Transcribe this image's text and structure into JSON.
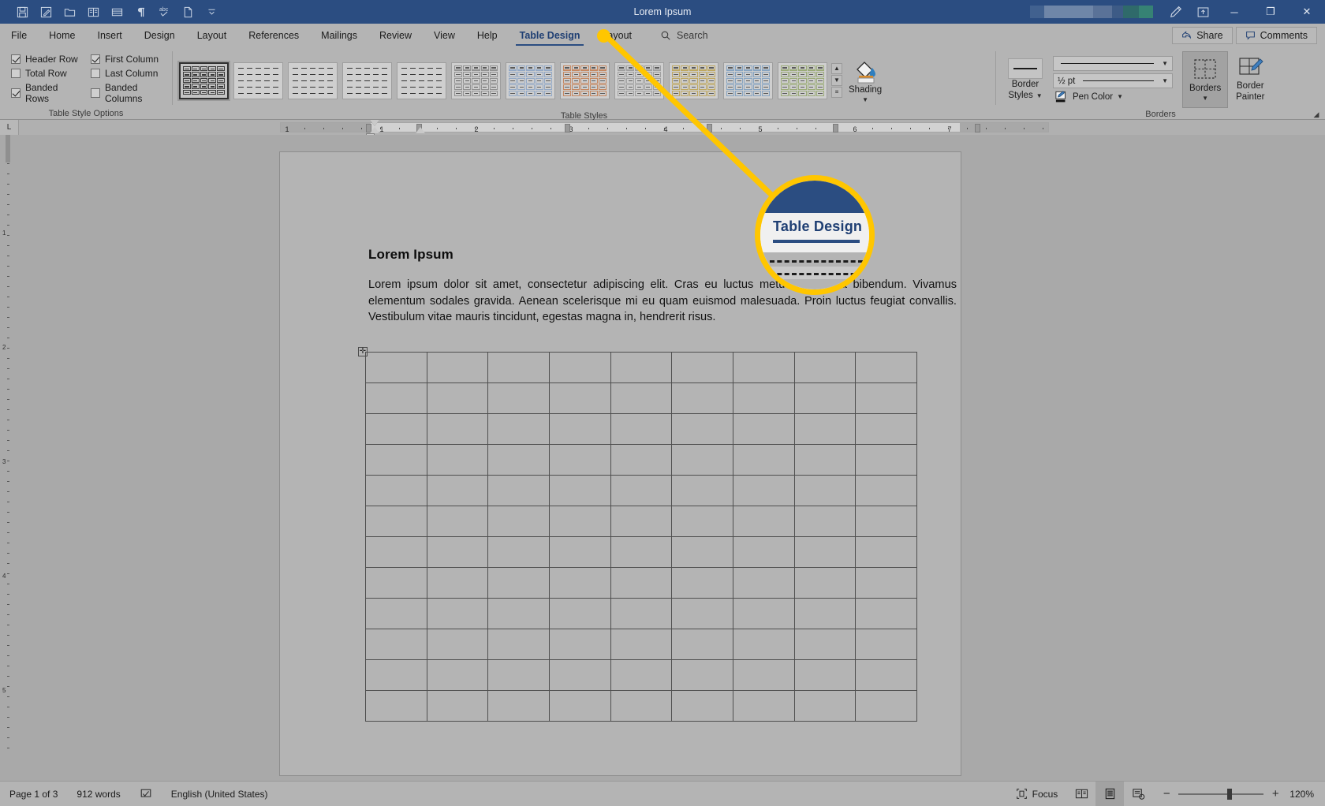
{
  "app": {
    "title": "Lorem Ipsum",
    "accent_blue": "#2b4d81",
    "callout_yellow": "#ffc600"
  },
  "quick_access": [
    {
      "name": "save-icon",
      "tooltip": "Save"
    },
    {
      "name": "autosave-icon",
      "tooltip": "AutoSave"
    },
    {
      "name": "open-folder-icon",
      "tooltip": "Open"
    },
    {
      "name": "read-mode-icon",
      "tooltip": "Read Mode"
    },
    {
      "name": "print-preview-icon",
      "tooltip": "Print Preview"
    },
    {
      "name": "paragraph-marks-icon",
      "tooltip": "Show/Hide Formatting"
    },
    {
      "name": "spelling-icon",
      "tooltip": "Spelling & Grammar"
    },
    {
      "name": "new-document-icon",
      "tooltip": "New"
    },
    {
      "name": "customize-qat-icon",
      "tooltip": "Customize Quick Access Toolbar"
    }
  ],
  "titlebar_right": {
    "pen_icon": "pen-icon",
    "ribbon_display_icon": "ribbon-display-options-icon",
    "minimize": "─",
    "restore": "❐",
    "close": "✕"
  },
  "tabs": [
    {
      "label": "File",
      "active": false
    },
    {
      "label": "Home",
      "active": false
    },
    {
      "label": "Insert",
      "active": false
    },
    {
      "label": "Design",
      "active": false
    },
    {
      "label": "Layout",
      "active": false
    },
    {
      "label": "References",
      "active": false
    },
    {
      "label": "Mailings",
      "active": false
    },
    {
      "label": "Review",
      "active": false
    },
    {
      "label": "View",
      "active": false
    },
    {
      "label": "Help",
      "active": false
    },
    {
      "label": "Table Design",
      "active": true
    },
    {
      "label": "Layout",
      "active": false
    }
  ],
  "search": {
    "placeholder": "Search",
    "value": "Search"
  },
  "tabstrip_right": {
    "share_label": "Share",
    "comments_label": "Comments"
  },
  "ribbon": {
    "groups": [
      {
        "label": "Table Style Options"
      },
      {
        "label": "Table Styles"
      },
      {
        "label": "Borders"
      }
    ],
    "table_style_options": [
      {
        "label": "Header Row",
        "checked": true
      },
      {
        "label": "First Column",
        "checked": true
      },
      {
        "label": "Total Row",
        "checked": false
      },
      {
        "label": "Last Column",
        "checked": false
      },
      {
        "label": "Banded Rows",
        "checked": true
      },
      {
        "label": "Banded Columns",
        "checked": false
      }
    ],
    "table_styles": [
      {
        "name": "Table Grid",
        "color": "#2f2f2f",
        "selected": true,
        "header": false
      },
      {
        "name": "Plain Table 1",
        "color": "#9a9a9a",
        "selected": false,
        "header": false
      },
      {
        "name": "Plain Table 2",
        "color": "#9a9a9a",
        "selected": false,
        "header": false
      },
      {
        "name": "Plain Table 3",
        "color": "#bdbdbd",
        "selected": false,
        "header": false
      },
      {
        "name": "Plain Table 4",
        "color": "#bdbdbd",
        "selected": false,
        "header": false
      },
      {
        "name": "Grid Table 1 Light",
        "color": "#7d7d7d",
        "selected": false,
        "header": true
      },
      {
        "name": "Grid Table 1 Light - Accent 1",
        "color": "#7f9dc4",
        "selected": false,
        "header": true
      },
      {
        "name": "Grid Table 1 Light - Accent 2",
        "color": "#c2703c",
        "selected": false,
        "header": true
      },
      {
        "name": "Grid Table 1 Light - Accent 3",
        "color": "#8f8f8f",
        "selected": false,
        "header": true
      },
      {
        "name": "Grid Table 1 Light - Accent 4",
        "color": "#b99a3c",
        "selected": false,
        "header": true
      },
      {
        "name": "Grid Table 1 Light - Accent 5",
        "color": "#6f96bd",
        "selected": false,
        "header": true
      },
      {
        "name": "Grid Table 1 Light - Accent 6",
        "color": "#8aa05c",
        "selected": false,
        "header": true
      }
    ],
    "gallery_scroll": [
      {
        "name": "gallery-scroll-up-button",
        "glyph": "▲"
      },
      {
        "name": "gallery-scroll-down-button",
        "glyph": "▼"
      },
      {
        "name": "gallery-more-button",
        "glyph": "≡"
      }
    ],
    "shading": {
      "label": "Shading",
      "icon": "paint-bucket-icon",
      "has_dropdown": true
    },
    "border_styles": {
      "label_line1": "Border",
      "label_line2": "Styles",
      "has_dropdown": true
    },
    "line_style": {
      "value": "",
      "icon": "line-style-dropdown"
    },
    "line_weight": {
      "value": "½ pt"
    },
    "pen_color": {
      "label": "Pen Color",
      "icon": "pen-color-icon",
      "has_dropdown": true
    },
    "borders_button": {
      "label": "Borders",
      "icon": "borders-grid-icon",
      "has_dropdown": true,
      "active": true
    },
    "border_painter": {
      "label_line1": "Border",
      "label_line2": "Painter",
      "icon": "border-painter-icon"
    }
  },
  "ruler": {
    "corner_label": "L",
    "ticks": [
      "1",
      "1",
      "2",
      "3",
      "4",
      "5",
      "6",
      "7"
    ]
  },
  "document": {
    "heading": "Lorem Ipsum",
    "paragraph": "Lorem ipsum dolor sit amet, consectetur adipiscing elit. Cras eu luctus metus ut viverra bibendum. Vivamus elementum sodales gravida. Aenean scelerisque mi eu quam euismod malesuada. Proin luctus feugiat convallis. Vestibulum vitae mauris tincidunt, egestas magna in, hendrerit risus.",
    "table": {
      "rows": 12,
      "cols": 9,
      "move_handle_glyph": "✛"
    }
  },
  "callout": {
    "zoom_label": "Table Design",
    "target_tab": "Table Design"
  },
  "status_bar": {
    "page": "Page 1 of 3",
    "words": "912 words",
    "proofing_icon": "proofing-errors-icon",
    "language": "English (United States)",
    "focus_label": "Focus",
    "views": [
      {
        "name": "read-mode-view-button",
        "active": false
      },
      {
        "name": "print-layout-view-button",
        "active": true
      },
      {
        "name": "web-layout-view-button",
        "active": false
      }
    ],
    "zoom_out": "−",
    "zoom_in": "+",
    "zoom_level": "120%"
  }
}
